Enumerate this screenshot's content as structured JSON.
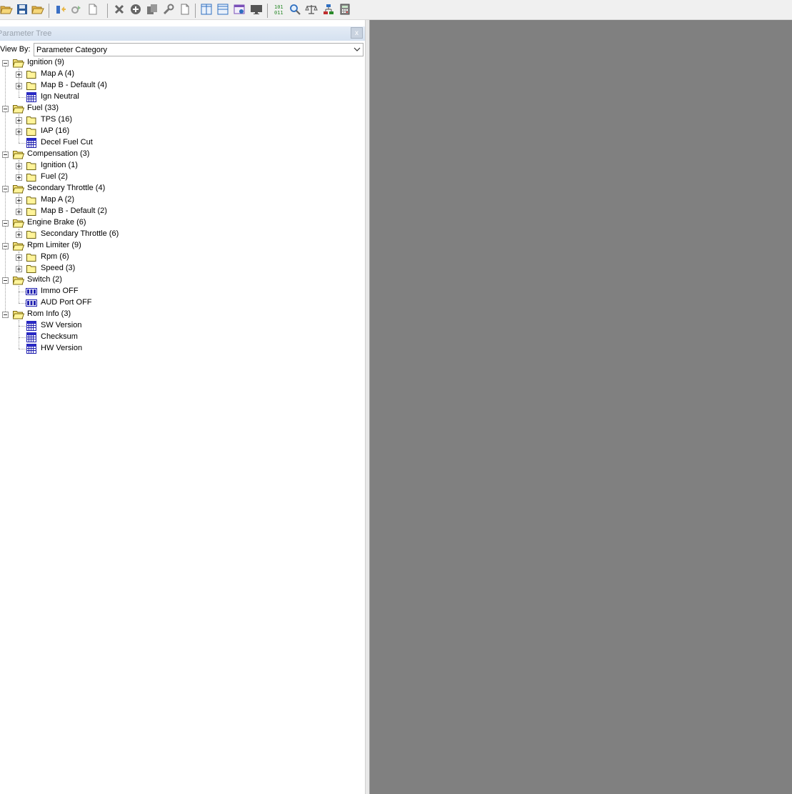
{
  "toolbar": {
    "buttons": [
      {
        "name": "open-icon",
        "color": "#e8b84a"
      },
      {
        "name": "save-icon",
        "color": "#2e5c9a"
      },
      {
        "name": "open-folder-icon",
        "color": "#e8b84a"
      },
      {
        "name": "read-ecu-icon",
        "color": "#3a6fc4"
      },
      {
        "name": "write-ecu-icon",
        "color": "#a0a0a0"
      },
      {
        "name": "new-document-icon",
        "color": "#888888"
      },
      {
        "name": "delete-icon",
        "color": "#666666"
      },
      {
        "name": "add-icon",
        "color": "#666666"
      },
      {
        "name": "copy-icon",
        "color": "#777777"
      },
      {
        "name": "wrench-icon",
        "color": "#777777"
      },
      {
        "name": "document-icon",
        "color": "#777777"
      },
      {
        "name": "split-vertical-icon",
        "color": "#2f6fc0"
      },
      {
        "name": "split-horizontal-icon",
        "color": "#2f6fc0"
      },
      {
        "name": "window-info-icon",
        "color": "#7a4fb8"
      },
      {
        "name": "monitor-icon",
        "color": "#555555"
      },
      {
        "name": "binary-icon",
        "color": "#2a8a2a"
      },
      {
        "name": "search-icon",
        "color": "#2f6fc0"
      },
      {
        "name": "compare-scale-icon",
        "color": "#555555"
      },
      {
        "name": "hierarchy-icon",
        "color": "#c03030"
      },
      {
        "name": "calculator-icon",
        "color": "#555555"
      }
    ]
  },
  "panel": {
    "title": "Parameter Tree",
    "close_label": "x",
    "view_by_label": "View By:",
    "view_by_value": "Parameter Category"
  },
  "tree": [
    {
      "label": "Ignition (9)",
      "level": 0,
      "type": "folder-open",
      "expanded": true
    },
    {
      "label": "Map A (4)",
      "level": 1,
      "type": "folder",
      "expanded": false
    },
    {
      "label": "Map B - Default (4)",
      "level": 1,
      "type": "folder",
      "expanded": false
    },
    {
      "label": "Ign Neutral",
      "level": 1,
      "type": "table"
    },
    {
      "label": "Fuel (33)",
      "level": 0,
      "type": "folder-open",
      "expanded": true
    },
    {
      "label": "TPS (16)",
      "level": 1,
      "type": "folder",
      "expanded": false
    },
    {
      "label": "IAP (16)",
      "level": 1,
      "type": "folder",
      "expanded": false
    },
    {
      "label": "Decel Fuel Cut",
      "level": 1,
      "type": "table"
    },
    {
      "label": "Compensation (3)",
      "level": 0,
      "type": "folder-open",
      "expanded": true
    },
    {
      "label": "Ignition (1)",
      "level": 1,
      "type": "folder",
      "expanded": false
    },
    {
      "label": "Fuel (2)",
      "level": 1,
      "type": "folder",
      "expanded": false
    },
    {
      "label": "Secondary Throttle (4)",
      "level": 0,
      "type": "folder-open",
      "expanded": true
    },
    {
      "label": "Map A (2)",
      "level": 1,
      "type": "folder",
      "expanded": false
    },
    {
      "label": "Map B - Default (2)",
      "level": 1,
      "type": "folder",
      "expanded": false
    },
    {
      "label": "Engine Brake (6)",
      "level": 0,
      "type": "folder-open",
      "expanded": true
    },
    {
      "label": "Secondary Throttle (6)",
      "level": 1,
      "type": "folder",
      "expanded": false
    },
    {
      "label": "Rpm Limiter (9)",
      "level": 0,
      "type": "folder-open",
      "expanded": true
    },
    {
      "label": "Rpm (6)",
      "level": 1,
      "type": "folder",
      "expanded": false
    },
    {
      "label": "Speed (3)",
      "level": 1,
      "type": "folder",
      "expanded": false
    },
    {
      "label": "Switch (2)",
      "level": 0,
      "type": "folder-open",
      "expanded": true
    },
    {
      "label": "Immo OFF",
      "level": 1,
      "type": "switch"
    },
    {
      "label": "AUD Port OFF",
      "level": 1,
      "type": "switch"
    },
    {
      "label": "Rom Info (3)",
      "level": 0,
      "type": "folder-open",
      "expanded": true
    },
    {
      "label": "SW Version",
      "level": 1,
      "type": "table"
    },
    {
      "label": "Checksum",
      "level": 1,
      "type": "table"
    },
    {
      "label": "HW Version",
      "level": 1,
      "type": "table"
    }
  ]
}
